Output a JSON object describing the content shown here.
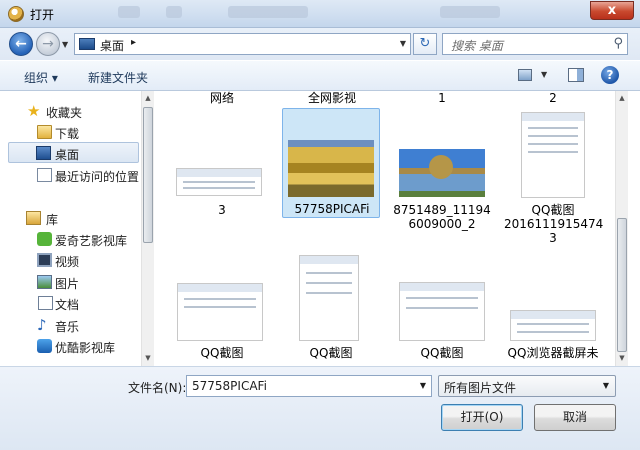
{
  "window": {
    "title": "打开",
    "close_label": "x"
  },
  "address_bar": {
    "location": "桌面",
    "separator": "▸",
    "search_placeholder": "搜索 桌面"
  },
  "toolbar": {
    "organize": "组织 ▾",
    "new_folder": "新建文件夹",
    "help": "?"
  },
  "nav_pane": {
    "items": [
      {
        "label": "收藏夹",
        "icon": "star-icon"
      },
      {
        "label": "下载",
        "icon": "downloads-folder-icon"
      },
      {
        "label": "桌面",
        "icon": "desktop-icon",
        "selected": true
      },
      {
        "label": "最近访问的位置",
        "icon": "recent-places-icon"
      },
      {
        "label": "库",
        "icon": "library-icon"
      },
      {
        "label": "爱奇艺影视库",
        "icon": "iqiyi-icon"
      },
      {
        "label": "视频",
        "icon": "video-library-icon"
      },
      {
        "label": "图片",
        "icon": "pictures-library-icon"
      },
      {
        "label": "文档",
        "icon": "documents-library-icon"
      },
      {
        "label": "音乐",
        "icon": "music-library-icon"
      },
      {
        "label": "优酷影视库",
        "icon": "youku-icon"
      }
    ]
  },
  "files": {
    "row1": [
      "网络",
      "全网影视",
      "1",
      "2"
    ],
    "items": [
      {
        "name": "3"
      },
      {
        "name": "57758PICAFi",
        "selected": true
      },
      {
        "name": "8751489_11194\n6009000_2"
      },
      {
        "name": "QQ截图\n2016111915474\n3"
      },
      {
        "name": "QQ截图"
      },
      {
        "name": "QQ截图"
      },
      {
        "name": "QQ截图"
      },
      {
        "name": "QQ浏览器截屏未"
      }
    ]
  },
  "footer": {
    "filename_label": "文件名(N):",
    "filename_value": "57758PICAFi",
    "filter_value": "所有图片文件",
    "open_button": "打开(O)",
    "cancel_button": "取消"
  }
}
